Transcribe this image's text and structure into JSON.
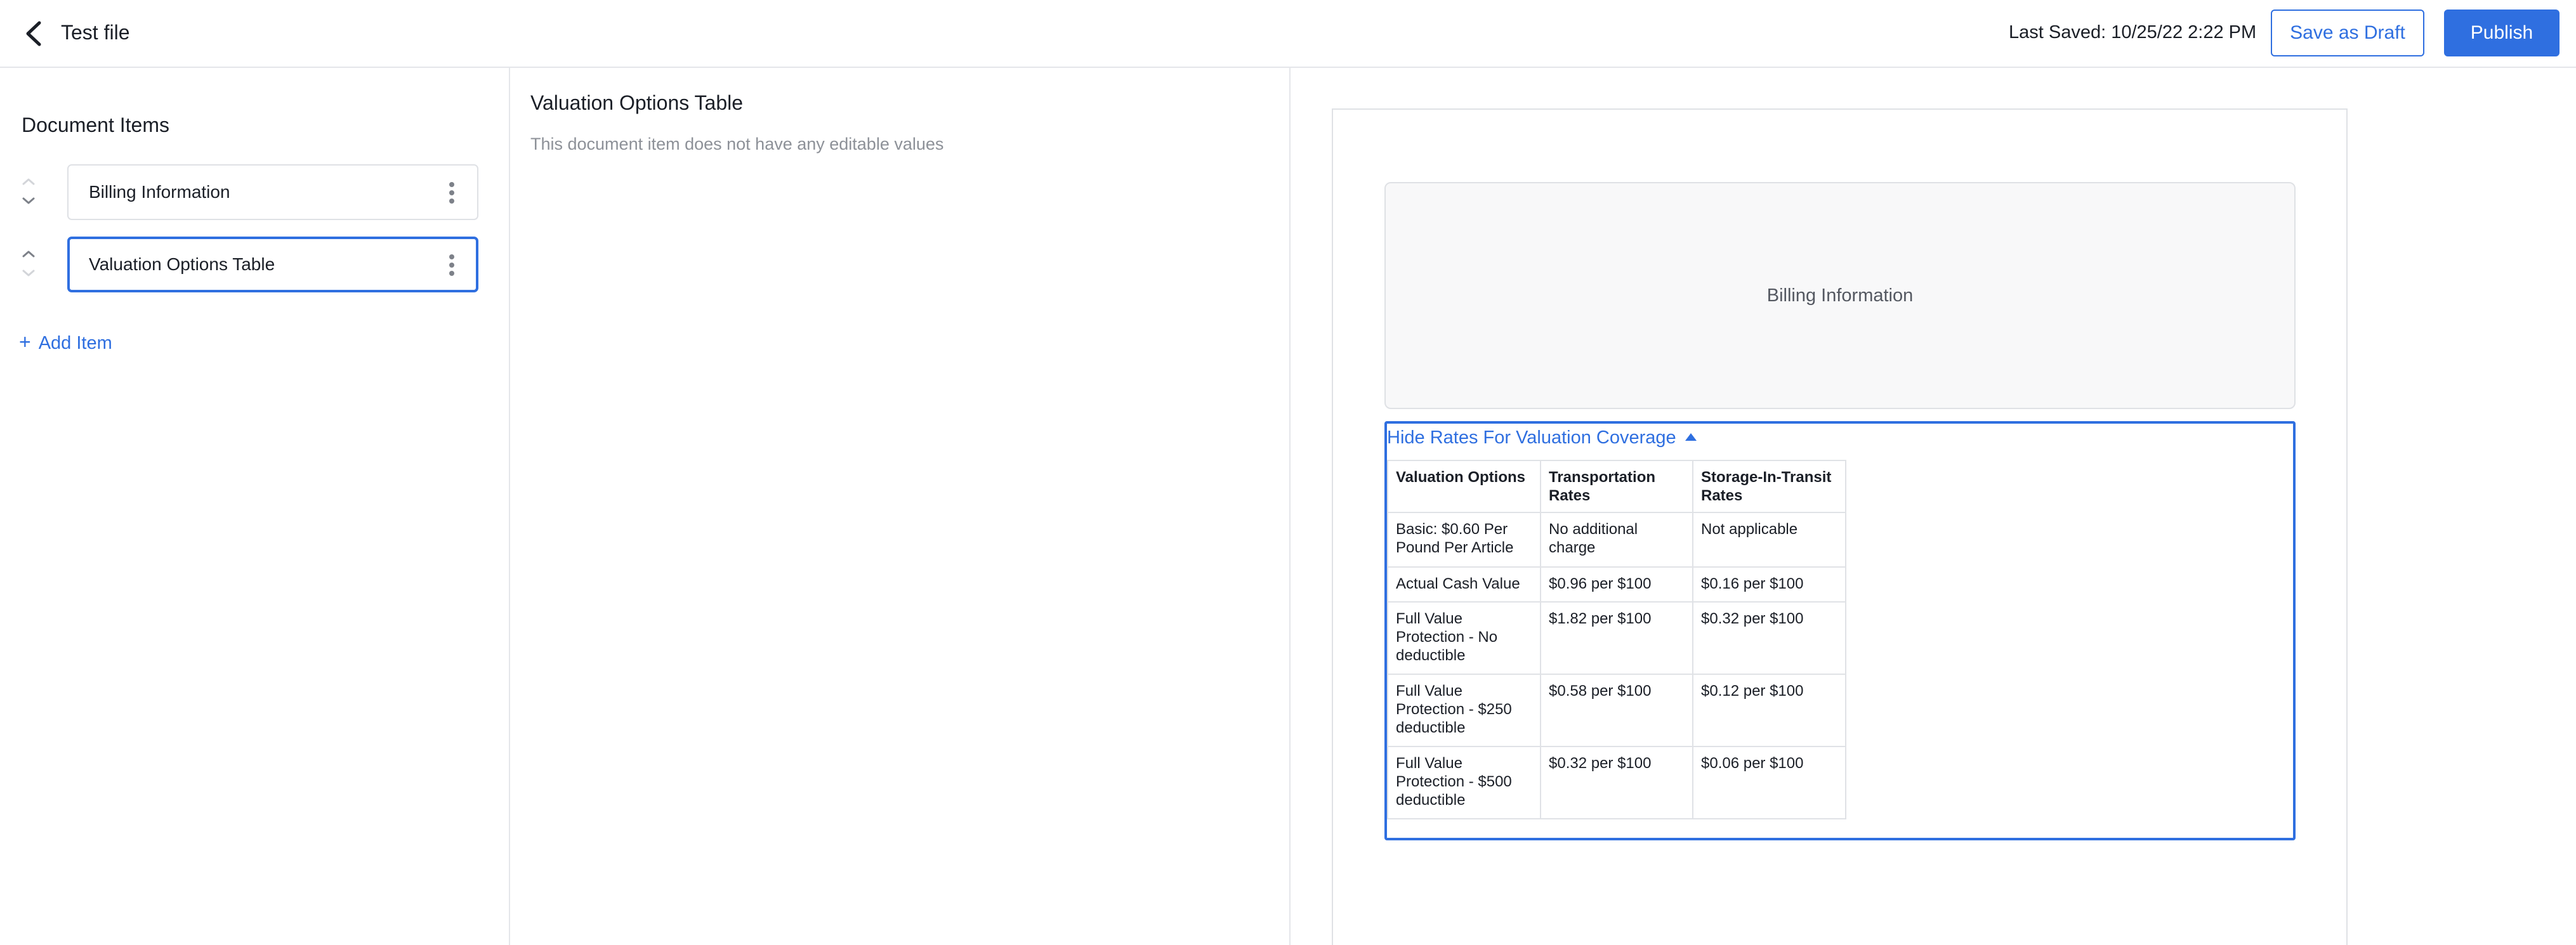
{
  "header": {
    "title": "Test file",
    "last_saved": "Last Saved: 10/25/22 2:22 PM",
    "save_draft_label": "Save as Draft",
    "publish_label": "Publish"
  },
  "left_panel": {
    "heading": "Document Items",
    "items": [
      {
        "label": "Billing Information"
      },
      {
        "label": "Valuation Options Table"
      }
    ],
    "add_item_label": "Add Item"
  },
  "middle_panel": {
    "title": "Valuation Options Table",
    "note": "This document item does not have any editable values"
  },
  "preview": {
    "billing_label": "Billing Information",
    "toggle_label": "Hide Rates For Valuation Coverage",
    "table": {
      "headers": [
        "Valuation Options",
        "Transportation Rates",
        "Storage-In-Transit Rates"
      ],
      "rows": [
        [
          "Basic: $0.60 Per Pound Per Article",
          "No additional charge",
          "Not applicable"
        ],
        [
          "Actual Cash Value",
          "$0.96 per $100",
          "$0.16 per $100"
        ],
        [
          "Full Value Protection - No deductible",
          "$1.82 per $100",
          "$0.32 per $100"
        ],
        [
          "Full Value Protection - $250 deductible",
          "$0.58 per $100",
          "$0.12 per $100"
        ],
        [
          "Full Value Protection - $500 deductible",
          "$0.32 per $100",
          "$0.06 per $100"
        ]
      ]
    }
  },
  "colors": {
    "accent": "#2f6fe0",
    "border": "#dfe1e5",
    "muted_text": "#8d9198"
  }
}
